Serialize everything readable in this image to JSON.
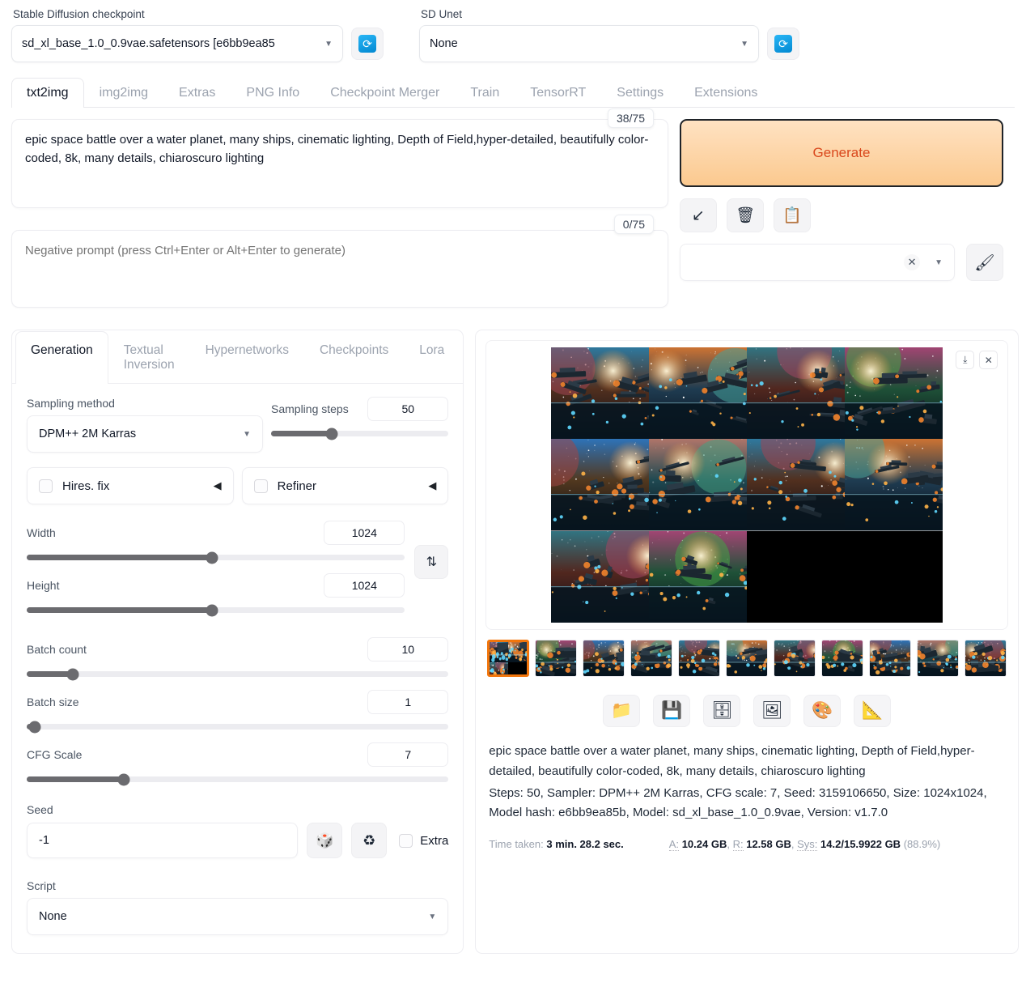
{
  "header": {
    "checkpoint_label": "Stable Diffusion checkpoint",
    "checkpoint_value": "sd_xl_base_1.0_0.9vae.safetensors [e6bb9ea85",
    "unet_label": "SD Unet",
    "unet_value": "None",
    "refresh_icon": "refresh-icon",
    "caret_icon": "chevron-down-icon"
  },
  "main_tabs": [
    {
      "label": "txt2img",
      "active": true
    },
    {
      "label": "img2img",
      "active": false
    },
    {
      "label": "Extras",
      "active": false
    },
    {
      "label": "PNG Info",
      "active": false
    },
    {
      "label": "Checkpoint Merger",
      "active": false
    },
    {
      "label": "Train",
      "active": false
    },
    {
      "label": "TensorRT",
      "active": false
    },
    {
      "label": "Settings",
      "active": false
    },
    {
      "label": "Extensions",
      "active": false
    }
  ],
  "prompt": {
    "positive_value": "epic space battle over a water planet, many ships, cinematic lighting, Depth of Field,hyper-detailed, beautifully color-coded, 8k, many details, chiaroscuro lighting",
    "positive_counter": "38/75",
    "negative_placeholder": "Negative prompt (press Ctrl+Enter or Alt+Enter to generate)",
    "negative_value": "",
    "negative_counter": "0/75"
  },
  "actions": {
    "generate_label": "Generate",
    "arrow_icon": "arrow-down-left-icon",
    "trash_icon": "trash-can-icon",
    "clipboard_icon": "clipboard-icon",
    "clear_icon": "clear-x-icon",
    "dropdown_icon": "chevron-down-icon",
    "brush_icon": "paintbrush-icon",
    "network_value": ""
  },
  "sub_tabs": [
    {
      "label": "Generation",
      "active": true
    },
    {
      "label": "Textual Inversion",
      "active": false
    },
    {
      "label": "Hypernetworks",
      "active": false
    },
    {
      "label": "Checkpoints",
      "active": false
    },
    {
      "label": "Lora",
      "active": false
    }
  ],
  "generation": {
    "sampling_method_label": "Sampling method",
    "sampling_method_value": "DPM++ 2M Karras",
    "sampling_steps_label": "Sampling steps",
    "sampling_steps_value": "50",
    "sampling_steps_percent": 34,
    "hires_fix_label": "Hires. fix",
    "hires_fix_checked": false,
    "refiner_label": "Refiner",
    "refiner_checked": false,
    "width_label": "Width",
    "width_value": "1024",
    "width_percent": 49,
    "height_label": "Height",
    "height_value": "1024",
    "height_percent": 49,
    "swap_icon": "swap-vertical-icon",
    "batch_count_label": "Batch count",
    "batch_count_value": "10",
    "batch_count_percent": 11,
    "batch_size_label": "Batch size",
    "batch_size_value": "1",
    "batch_size_percent": 2,
    "cfg_scale_label": "CFG Scale",
    "cfg_scale_value": "7",
    "cfg_scale_percent": 23,
    "seed_label": "Seed",
    "seed_value": "-1",
    "dice_icon": "dice-icon",
    "recycle_icon": "recycle-icon",
    "extra_label": "Extra",
    "extra_checked": false,
    "script_label": "Script",
    "script_value": "None"
  },
  "result": {
    "download_icon": "download-icon",
    "close_icon": "close-icon",
    "toolbar": [
      {
        "icon": "folder-icon",
        "glyph": "📁"
      },
      {
        "icon": "floppy-disk-icon",
        "glyph": "💾"
      },
      {
        "icon": "file-cabinet-icon",
        "glyph": "🗄"
      },
      {
        "icon": "framed-picture-icon",
        "glyph": "🖼"
      },
      {
        "icon": "artist-palette-icon",
        "glyph": "🎨"
      },
      {
        "icon": "triangular-ruler-icon",
        "glyph": "📐"
      }
    ],
    "info_prompt": "epic space battle over a water planet, many ships, cinematic lighting, Depth of Field,hyper-detailed, beautifully color-coded, 8k, many details, chiaroscuro lighting",
    "info_params": "Steps: 50, Sampler: DPM++ 2M Karras, CFG scale: 7, Seed: 3159106650, Size: 1024x1024, Model hash: e6bb9ea85b, Model: sd_xl_base_1.0_0.9vae, Version: v1.7.0",
    "time_taken_label": "Time taken:",
    "time_taken_value": "3 min. 28.2 sec.",
    "mem_a_label": "A:",
    "mem_a_value": "10.24 GB",
    "mem_r_label": "R:",
    "mem_r_value": "12.58 GB",
    "mem_sys_label": "Sys:",
    "mem_sys_value": "14.2/15.9922 GB",
    "mem_sys_percent": "(88.9%)",
    "thumbnail_count": 11,
    "selected_thumbnail": 0
  },
  "colors": {
    "accent_orange": "#f2760c",
    "generate_text": "#d9471c",
    "generate_bg_top": "#ffe2c2",
    "generate_bg_bottom": "#fbc98f",
    "refresh_blue": "#0288d1",
    "slider_fill": "#6b6b6f"
  }
}
